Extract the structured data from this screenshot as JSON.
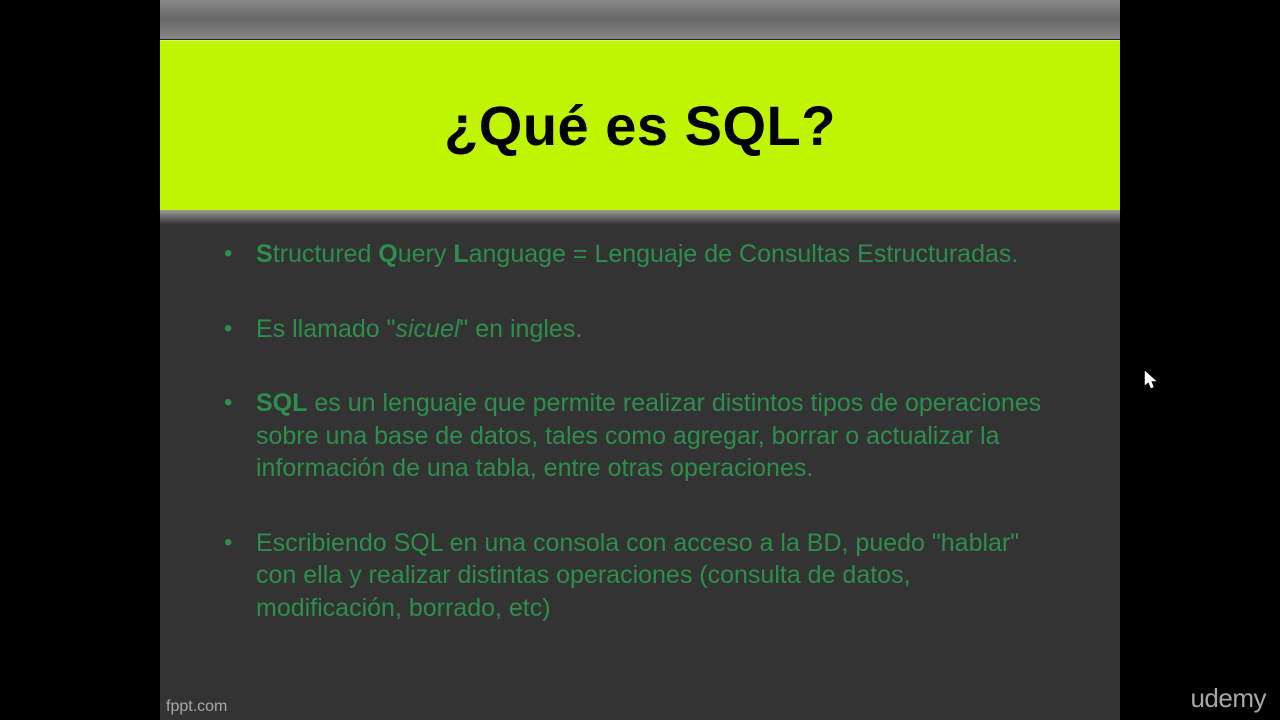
{
  "title": "¿Qué es SQL?",
  "bullets": {
    "b1": {
      "s1": "S",
      "s2": "tructured ",
      "s3": "Q",
      "s4": "uery ",
      "s5": "L",
      "s6": "anguage = Lenguaje de Consultas Estructuradas."
    },
    "b2": {
      "s1": "Es llamado \"",
      "s2": "sicuel",
      "s3": "\" en ingles."
    },
    "b3": {
      "s0": " ",
      "s1": "SQL",
      "s2": " es un lenguaje que permite realizar distintos tipos de operaciones sobre una base de datos, tales como agregar, borrar o actualizar la información de una tabla, entre otras operaciones."
    },
    "b4": {
      "s1": "Escribiendo SQL en una consola con acceso a la BD, puedo \"hablar\" con ella y realizar distintas operaciones (consulta de datos, modificación, borrado, etc)"
    }
  },
  "footer_left": "fppt.com",
  "watermark": "udemy"
}
